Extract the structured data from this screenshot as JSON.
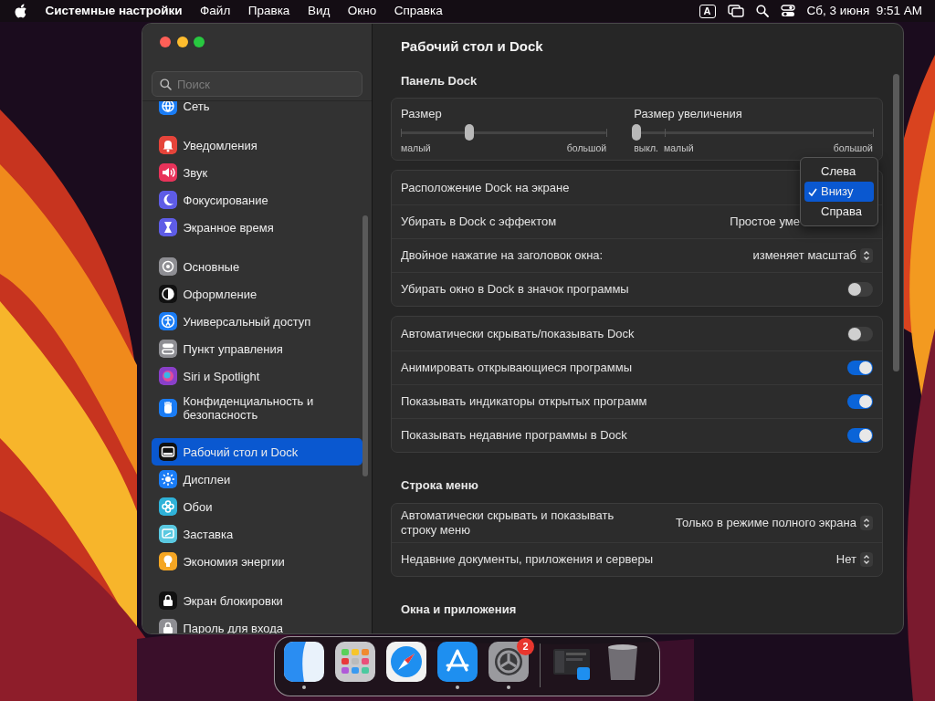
{
  "menu_bar": {
    "app": "Системные настройки",
    "items": [
      "Файл",
      "Правка",
      "Вид",
      "Окно",
      "Справка"
    ],
    "input_source": "A",
    "clock": "Сб, 3 июня  9:51 AM"
  },
  "sidebar": {
    "search": {
      "placeholder": "Поиск"
    },
    "groups": [
      [
        {
          "label": "Сеть",
          "color": "#1a7cf5",
          "selected": false
        }
      ],
      [
        {
          "label": "Уведомления",
          "color": "#e5443a",
          "selected": false
        },
        {
          "label": "Звук",
          "color": "#e8335a",
          "selected": false
        },
        {
          "label": "Фокусирование",
          "color": "#5e5ce6",
          "selected": false
        },
        {
          "label": "Экранное время",
          "color": "#5e5ce6",
          "selected": false
        }
      ],
      [
        {
          "label": "Основные",
          "color": "#8e8e93",
          "selected": false
        },
        {
          "label": "Оформление",
          "color": "#111111",
          "selected": false
        },
        {
          "label": "Универсальный доступ",
          "color": "#1a7cf5",
          "selected": false
        },
        {
          "label": "Пункт управления",
          "color": "#8e8e93",
          "selected": false
        },
        {
          "label": "Siri и Spotlight",
          "color": "#8a3fc8",
          "selected": false
        },
        {
          "label": "Конфиденциальность и безопасность",
          "color": "#1a7cf5",
          "selected": false
        }
      ],
      [
        {
          "label": "Рабочий стол и Dock",
          "color": "#111111",
          "selected": true
        },
        {
          "label": "Дисплеи",
          "color": "#1a7cf5",
          "selected": false
        },
        {
          "label": "Обои",
          "color": "#2fb2d8",
          "selected": false
        },
        {
          "label": "Заставка",
          "color": "#5ac8e0",
          "selected": false
        },
        {
          "label": "Экономия энергии",
          "color": "#f5a623",
          "selected": false
        }
      ],
      [
        {
          "label": "Экран блокировки",
          "color": "#111111",
          "selected": false
        },
        {
          "label": "Пароль для входа",
          "color": "#8e8e93",
          "selected": false
        }
      ]
    ]
  },
  "window": {
    "title": "Рабочий стол и Dock"
  },
  "sections": [
    {
      "heading": "Панель Dock",
      "cards": [
        {
          "kind": "sliders",
          "sliders": [
            {
              "label": "Размер",
              "level": 0.33,
              "scale": [
                "малый",
                "большой"
              ]
            },
            {
              "label": "Размер увеличения",
              "level": 0,
              "scale": [
                "выкл.",
                "малый",
                "большой"
              ]
            }
          ]
        },
        {
          "kind": "rows",
          "rows": [
            {
              "kind": "popup",
              "label": "Расположение Dock на экране",
              "expanded": true,
              "options": [
                {
                  "label": "Слева",
                  "selected": false
                },
                {
                  "label": "Внизу",
                  "selected": true
                },
                {
                  "label": "Справа",
                  "selected": false
                }
              ]
            },
            {
              "kind": "popup",
              "label": "Убирать в Dock с эффектом",
              "value": "Простое уме"
            },
            {
              "kind": "popup",
              "label": "Двойное нажатие на заголовок окна:",
              "value": "изменяет масштаб"
            },
            {
              "kind": "toggle",
              "label": "Убирать окно в Dock в значок программы",
              "on": false
            }
          ]
        },
        {
          "kind": "rows",
          "rows": [
            {
              "kind": "toggle",
              "label": "Автоматически скрывать/показывать Dock",
              "on": false
            },
            {
              "kind": "toggle",
              "label": "Анимировать открывающиеся программы",
              "on": true
            },
            {
              "kind": "toggle",
              "label": "Показывать индикаторы открытых программ",
              "on": true
            },
            {
              "kind": "toggle",
              "label": "Показывать недавние программы в Dock",
              "on": true
            }
          ]
        }
      ]
    },
    {
      "heading": "Строка меню",
      "cards": [
        {
          "kind": "rows",
          "rows": [
            {
              "kind": "popup",
              "label": "Автоматически скрывать и показывать строку меню",
              "value": "Только в режиме полного экрана"
            },
            {
              "kind": "popup",
              "label": "Недавние документы, приложения и серверы",
              "value": "Нет"
            }
          ]
        }
      ]
    },
    {
      "heading": "Окна и приложения"
    }
  ],
  "dock": {
    "apps": [
      {
        "running": true
      },
      {
        "running": false
      },
      {
        "running": false
      },
      {
        "running": true
      },
      {
        "running": true,
        "badge": "2"
      }
    ],
    "recent": [
      {
        "running": false
      }
    ],
    "trash": {
      "running": false
    }
  }
}
